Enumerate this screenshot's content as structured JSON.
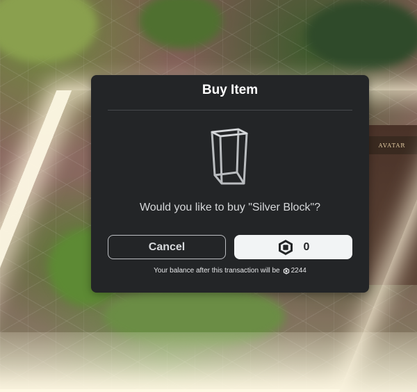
{
  "background": {
    "sign_text": "AVATAR"
  },
  "dialog": {
    "title": "Buy Item",
    "item_icon": "silver-block-frame-icon",
    "prompt": "Would you like to buy \"Silver Block\"?",
    "cancel_label": "Cancel",
    "buy_price": "0",
    "currency_icon": "robux-icon",
    "balance_text": "Your balance after this transaction will be",
    "balance_amount": "2244"
  },
  "colors": {
    "dialog_bg": "#232527",
    "buy_button_bg": "#f2f4f5",
    "cancel_border": "#bcbec2",
    "divider": "#46494d"
  }
}
